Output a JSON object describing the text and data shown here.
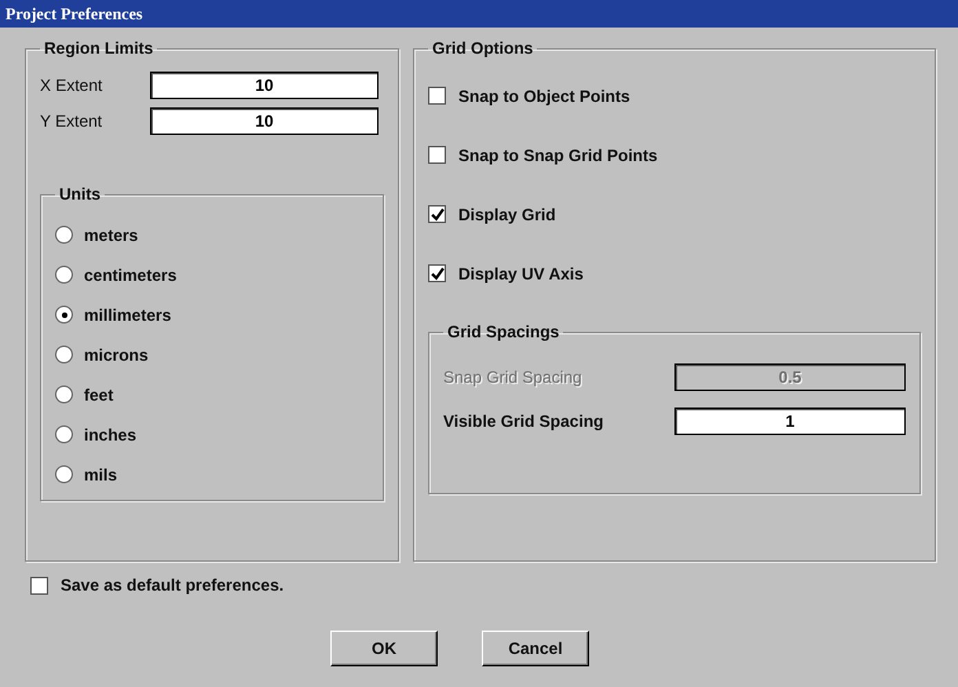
{
  "window": {
    "title": "Project Preferences"
  },
  "region_limits": {
    "title": "Region Limits",
    "fields": [
      {
        "label": "X Extent",
        "value": "10"
      },
      {
        "label": "Y Extent",
        "value": "10"
      }
    ],
    "units": {
      "title": "Units",
      "options": [
        {
          "label": "meters",
          "selected": false
        },
        {
          "label": "centimeters",
          "selected": false
        },
        {
          "label": "millimeters",
          "selected": true
        },
        {
          "label": "microns",
          "selected": false
        },
        {
          "label": "feet",
          "selected": false
        },
        {
          "label": "inches",
          "selected": false
        },
        {
          "label": "mils",
          "selected": false
        }
      ]
    }
  },
  "grid_options": {
    "title": "Grid Options",
    "checkboxes": [
      {
        "label": "Snap to Object Points",
        "checked": false
      },
      {
        "label": "Snap to Snap Grid Points",
        "checked": false
      },
      {
        "label": "Display Grid",
        "checked": true
      },
      {
        "label": "Display UV Axis",
        "checked": true
      }
    ],
    "grid_spacings": {
      "title": "Grid Spacings",
      "fields": [
        {
          "label": "Snap Grid Spacing",
          "value": "0.5",
          "disabled": true
        },
        {
          "label": "Visible Grid Spacing",
          "value": "1",
          "disabled": false
        }
      ]
    }
  },
  "save_default": {
    "label": "Save as default preferences.",
    "checked": false
  },
  "buttons": [
    "OK",
    "Cancel"
  ]
}
